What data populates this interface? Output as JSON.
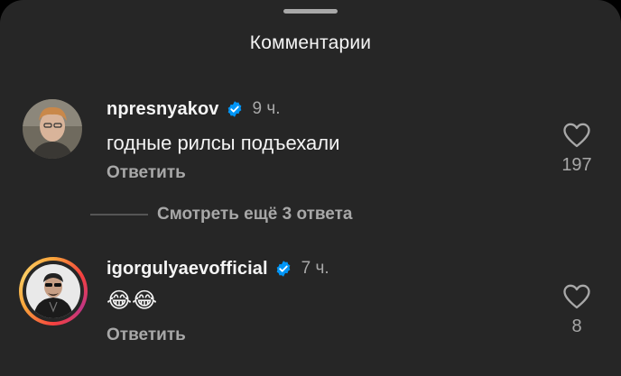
{
  "sheet": {
    "title": "Комментарии"
  },
  "comments": [
    {
      "username": "npresnyakov",
      "time": "9 ч.",
      "text": "годные рилсы подъехали",
      "reply_label": "Ответить",
      "likes": "197",
      "verified": true
    },
    {
      "username": "igorgulyaevofficial",
      "time": "7 ч.",
      "text": "😂😂",
      "reply_label": "Ответить",
      "likes": "8",
      "verified": true,
      "has_story": true
    }
  ],
  "replies": {
    "view_more_label": "Смотреть ещё 3 ответа"
  },
  "colors": {
    "background": "#262626",
    "primary_text": "#f5f5f5",
    "secondary_text": "#a8a8a8",
    "verified_blue": "#0095f6"
  },
  "icons": [
    "verified-badge-icon",
    "heart-icon"
  ]
}
